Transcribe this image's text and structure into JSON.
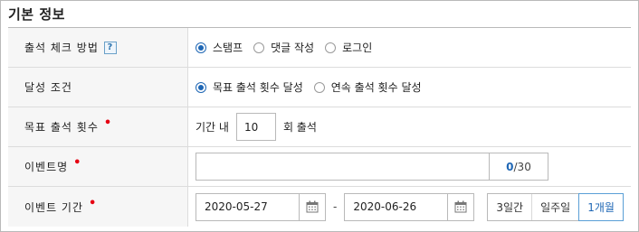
{
  "panel": {
    "title": "기본 정보"
  },
  "method": {
    "label": "출석 체크 방법",
    "help_icon": "?",
    "options": [
      "스탬프",
      "댓글 작성",
      "로그인"
    ],
    "selected": 0
  },
  "condition": {
    "label": "달성 조건",
    "options": [
      "목표 출석 횟수 달성",
      "연속 출석 횟수 달성"
    ],
    "selected": 0
  },
  "target": {
    "label": "목표 출석 횟수",
    "required_mark": "•",
    "prefix": "기간 내",
    "value": "10",
    "suffix": "회 출석"
  },
  "event_name": {
    "label": "이벤트명",
    "required_mark": "•",
    "value": "",
    "count_current": "0",
    "count_max": "/30"
  },
  "period": {
    "label": "이벤트 기간",
    "required_mark": "•",
    "start": "2020-05-27",
    "separator": "-",
    "end": "2020-06-26",
    "quick": [
      "3일간",
      "일주일",
      "1개월"
    ],
    "quick_active": 2
  },
  "colors": {
    "accent": "#1f67b5",
    "required": "#e60012"
  }
}
